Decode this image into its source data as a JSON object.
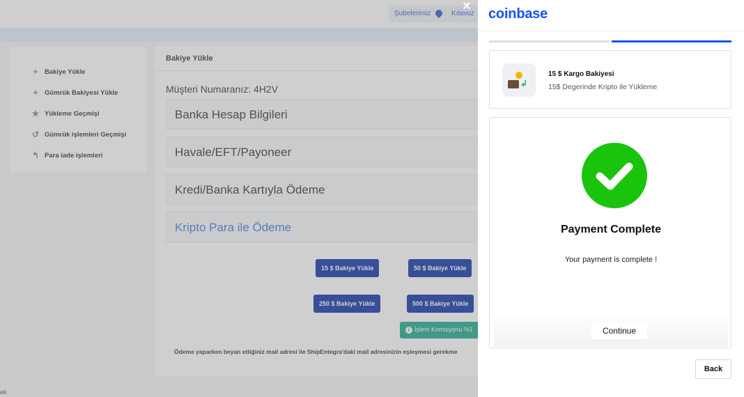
{
  "background": {
    "topbar": {
      "branches_label": "Şubelerimiz",
      "guide_label": "Kılavuz"
    },
    "sidebar": {
      "items": [
        {
          "label": "Bakiye Yükle",
          "icon": "plus-icon"
        },
        {
          "label": "Gümrük Bakiyesi Yükle",
          "icon": "plus-icon"
        },
        {
          "label": "Yükleme Geçmişi",
          "icon": "star-icon"
        },
        {
          "label": "Gümrük işlemleri Geçmişi",
          "icon": "history-icon"
        },
        {
          "label": "Para iade işlemleri",
          "icon": "reply-icon"
        }
      ]
    },
    "main": {
      "header": "Bakiye Yükle",
      "customer_number": "Müşteri Numaranız: 4H2V",
      "sections": [
        "Banka Hesap Bilgileri",
        "Havale/EFT/Payoneer",
        "Kredi/Banka Kartıyla Ödeme",
        "Kripto Para ile Ödeme"
      ],
      "buttons": [
        "15 $ Bakiye Yükle",
        "50 $ Bakiye Yükle",
        "250 $ Bakiye Yükle",
        "500 $ Bakiye Yükle"
      ],
      "fee_badge": "İşlem Komisyonu %1",
      "note": "Ödeme yaparken beyan ettiğiniz mail adresi ile ShipEntegra'daki mail adresinizin eşleşmesi gerekme"
    },
    "bottom_text": "ek"
  },
  "modal": {
    "close_glyph": "×",
    "logo": "coinbase",
    "accent_color": "#1652f0",
    "product": {
      "title": "15 $ Kargo Bakiyesi",
      "subtitle": "15$ Degerinde Kripto ile Yükleme"
    },
    "status": {
      "icon": "check-circle-icon",
      "color": "#1ac40d",
      "title": "Payment Complete",
      "message": "Your payment is complete !"
    },
    "continue_label": "Continue",
    "back_label": "Back"
  }
}
